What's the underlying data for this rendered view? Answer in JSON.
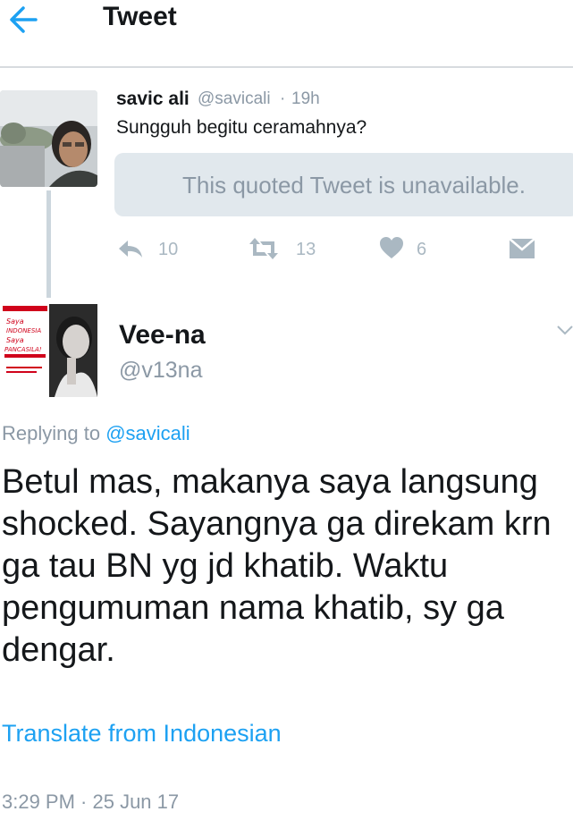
{
  "header": {
    "title": "Tweet"
  },
  "parent_tweet": {
    "name": "savic ali",
    "handle": "@savicali",
    "separator": "·",
    "time": "19h",
    "text": "Sungguh begitu ceramahnya?",
    "quoted_unavailable": "This quoted Tweet is unavailable.",
    "actions": {
      "reply_count": "10",
      "retweet_count": "13",
      "like_count": "6"
    }
  },
  "main_tweet": {
    "name": "Vee-na",
    "handle": "@v13na",
    "replying_prefix": "Replying to ",
    "replying_to": "@savicali",
    "text": "Betul mas, makanya saya langsung shocked. Sayangnya ga direkam krn ga tau BN yg jd khatib. Waktu pengumuman nama khatib, sy ga dengar.",
    "translate": "Translate from Indonesian",
    "timestamp": "3:29 PM · 25 Jun 17"
  },
  "colors": {
    "accent": "#1da1f2",
    "muted": "#8b98a5",
    "icon_gray": "#aab8c2",
    "quote_bg": "#e1e8ed",
    "text": "#14171a"
  },
  "icons": [
    "back-arrow-icon",
    "reply-icon",
    "retweet-icon",
    "like-icon",
    "direct-message-icon",
    "chevron-down-icon"
  ]
}
